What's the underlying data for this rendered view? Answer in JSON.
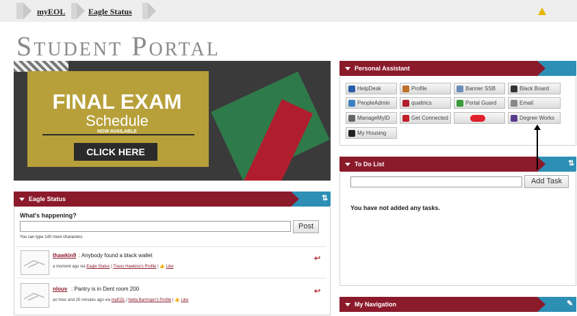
{
  "breadcrumb": {
    "item1": "myEOL",
    "item2": "Eagle Status",
    "alert_icon": "warning-icon"
  },
  "page": {
    "title": "Student Portal"
  },
  "banner": {
    "line1": "FINAL EXAM",
    "line2": "Schedule",
    "line3": "NOW AVAILABLE",
    "button": "CLICK HERE"
  },
  "personal_assistant": {
    "title": "Personal Assistant",
    "buttons": [
      {
        "label": "HelpDesk",
        "icon": "question-icon",
        "color": "#2a5ea8"
      },
      {
        "label": "Profile",
        "icon": "users-icon",
        "color": "#c0702a"
      },
      {
        "label": "Banner SSB",
        "icon": "id-card-icon",
        "color": "#6c8db8"
      },
      {
        "label": "Black Board",
        "icon": "blackboard-icon",
        "color": "#333333"
      },
      {
        "label": "PeopleAdmin",
        "icon": "people-icon",
        "color": "#3a7fc0"
      },
      {
        "label": "qualtrics",
        "icon": "qualtrics-icon",
        "color": "#b01e2e"
      },
      {
        "label": "Portal Guard",
        "icon": "lock-icon",
        "color": "#3a9a3a"
      },
      {
        "label": "Email",
        "icon": "envelope-icon",
        "color": "#888888"
      },
      {
        "label": "ManageMyID",
        "icon": "calendar-icon",
        "color": "#666666"
      },
      {
        "label": "Get Connected",
        "icon": "connect-icon",
        "color": "#c0202a"
      },
      {
        "label": "",
        "icon": "readiness-icon",
        "color": "#e0202a"
      },
      {
        "label": "Degree Works",
        "icon": "graduation-icon",
        "color": "#5a3a8a"
      },
      {
        "label": "My Housing",
        "icon": "housing-icon",
        "color": "#222222"
      }
    ]
  },
  "todo": {
    "title": "To Do List",
    "add_button": "Add Task",
    "empty_message": "You have not added any tasks."
  },
  "eagle_status": {
    "title": "Eagle Status",
    "question": "What's happening?",
    "post_button": "Post",
    "hint": "You can type 140 more characters.",
    "posts": [
      {
        "user": "thawkin9",
        "text": ": Anybody found a black wallet",
        "time": "a moment ago via",
        "via": "Eagle Status",
        "sep": "|",
        "profile": "Travis Hawkins's Profile",
        "like": "Like"
      },
      {
        "user": "nlouv",
        "text": ": Pantry is in Dent room 200",
        "time": "an hour and 20 minutes ago via",
        "via": "myEOL",
        "sep": "|",
        "profile": "Nella Barringer's Profile",
        "like": "Like"
      }
    ]
  },
  "navigation": {
    "title": "My Navigation"
  },
  "colors": {
    "header_bar": "#8b1a2b",
    "tab_blue": "#2e8fb5"
  }
}
